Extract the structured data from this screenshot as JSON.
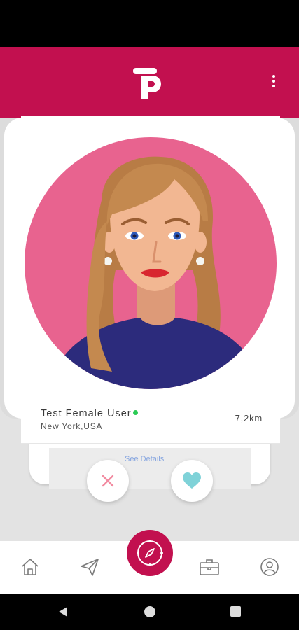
{
  "colors": {
    "brand": "#c2104f",
    "avatar_bg": "#e8638f",
    "online": "#2bcb55",
    "like": "#7fd2d8",
    "dislike": "#f28aa0"
  },
  "header": {
    "logo": "tp-logo",
    "menu_icon": "more-vertical-icon"
  },
  "profile": {
    "name": "Test Female User",
    "location": "New York,USA",
    "distance": "7,2km",
    "details_link": "See Details"
  },
  "actions": {
    "dislike_icon": "close-icon",
    "like_icon": "heart-icon"
  },
  "bottom_nav": {
    "items": [
      "home-icon",
      "send-icon",
      "compass-icon",
      "briefcase-icon",
      "user-icon"
    ]
  }
}
